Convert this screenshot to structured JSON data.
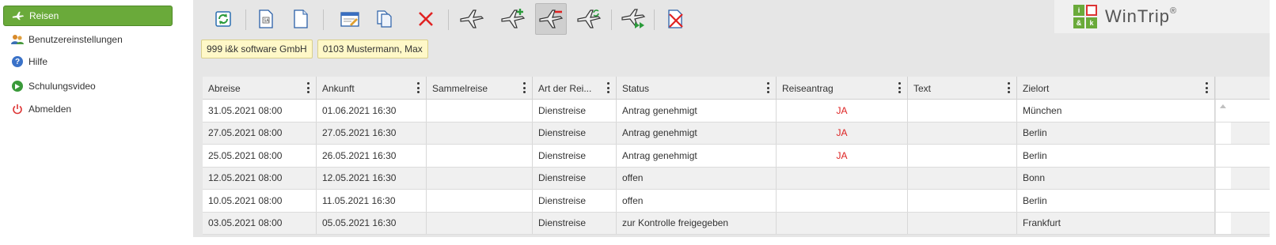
{
  "sidebar": {
    "items": [
      {
        "label": "Reisen",
        "icon": "airplane-icon",
        "active": true
      },
      {
        "label": "Benutzereinstellungen",
        "icon": "users-icon",
        "active": false
      },
      {
        "label": "Hilfe",
        "icon": "help-icon",
        "active": false
      },
      {
        "label": "Schulungsvideo",
        "icon": "play-icon",
        "active": false
      },
      {
        "label": "Abmelden",
        "icon": "power-icon",
        "active": false
      }
    ]
  },
  "toolbar": {
    "buttons": [
      {
        "name": "refresh-button",
        "icon": "refresh-icon"
      },
      {
        "name": "sa-form-button",
        "icon": "document-sa-icon"
      },
      {
        "name": "new-document-button",
        "icon": "blank-document-icon"
      },
      {
        "name": "edit-button",
        "icon": "edit-form-icon"
      },
      {
        "name": "copy-button",
        "icon": "copy-icon"
      },
      {
        "name": "delete-button",
        "icon": "delete-x-icon"
      },
      {
        "name": "trip-button",
        "icon": "airplane-icon"
      },
      {
        "name": "add-trip-button",
        "icon": "airplane-plus-icon"
      },
      {
        "name": "remove-trip-button",
        "icon": "airplane-minus-icon"
      },
      {
        "name": "sync-trip-button",
        "icon": "airplane-sync-icon"
      },
      {
        "name": "forward-trip-button",
        "icon": "airplane-forward-icon"
      },
      {
        "name": "cancel-document-button",
        "icon": "document-cancel-icon"
      }
    ]
  },
  "logo": {
    "text": "WinTrip",
    "reg": "®",
    "mark": [
      "i",
      "",
      "&",
      "k"
    ]
  },
  "context": {
    "company": "999 i&k software GmbH",
    "user": "0103 Mustermann, Max"
  },
  "colors": {
    "accent_green": "#6aaa3a",
    "status_red": "#dd2222"
  },
  "table": {
    "columns": [
      "Abreise",
      "Ankunft",
      "Sammelreise",
      "Art der Rei...",
      "Status",
      "Reiseantrag",
      "Text",
      "Zielort"
    ],
    "rows": [
      [
        "31.05.2021 08:00",
        "01.06.2021 16:30",
        "",
        "Dienstreise",
        "Antrag genehmigt",
        "JA",
        "",
        "München"
      ],
      [
        "27.05.2021 08:00",
        "27.05.2021 16:30",
        "",
        "Dienstreise",
        "Antrag genehmigt",
        "JA",
        "",
        "Berlin"
      ],
      [
        "25.05.2021 08:00",
        "26.05.2021 16:30",
        "",
        "Dienstreise",
        "Antrag genehmigt",
        "JA",
        "",
        "Berlin"
      ],
      [
        "12.05.2021 08:00",
        "12.05.2021 16:30",
        "",
        "Dienstreise",
        "offen",
        "",
        "",
        "Bonn"
      ],
      [
        "10.05.2021 08:00",
        "11.05.2021 16:30",
        "",
        "Dienstreise",
        "offen",
        "",
        "",
        "Berlin"
      ],
      [
        "03.05.2021 08:00",
        "05.05.2021 16:30",
        "",
        "Dienstreise",
        "zur Kontrolle freigegeben",
        "",
        "",
        "Frankfurt"
      ]
    ]
  }
}
